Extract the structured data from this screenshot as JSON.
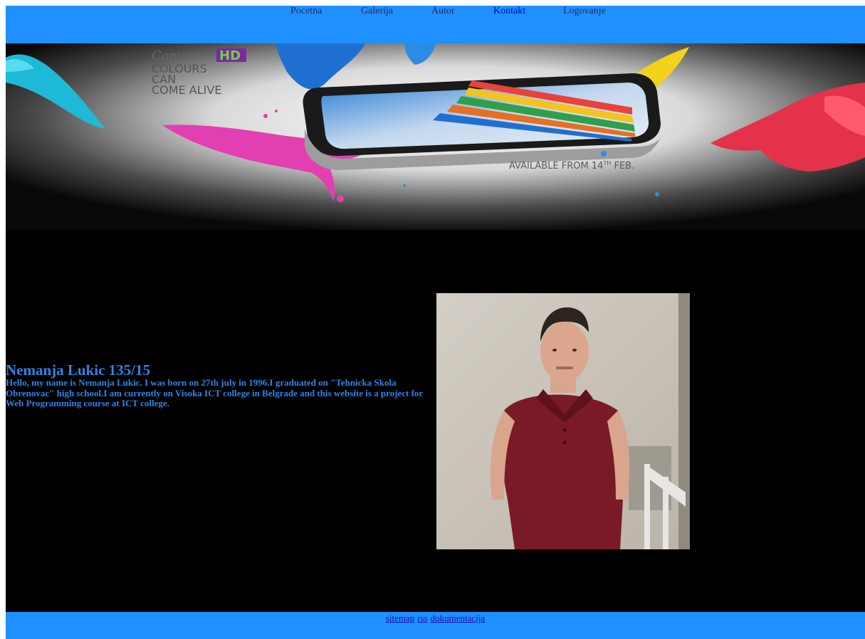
{
  "nav": {
    "items": [
      {
        "label": "Pocetna"
      },
      {
        "label": "Galerija"
      },
      {
        "label": "Autor"
      },
      {
        "label": "Kontakt"
      },
      {
        "label": "Logovanje"
      }
    ]
  },
  "banner": {
    "brand_prefix": "Canvas",
    "brand_suffix": "HD",
    "tagline_1": "COLOURS",
    "tagline_2": "CAN",
    "tagline_3": "COME ALIVE",
    "availability_main": "AVAILABLE FROM 14",
    "availability_sup": "TH",
    "availability_end": " FEB."
  },
  "about": {
    "title": "Nemanja Lukic 135/15",
    "text": "Hello, my name is Nemanja Lukic. I was born on 27th july in 1996.I graduated on \"Tehnicka Skola Obrenovac\" high school.I am currently on Visoka ICT college in Belgrade and this website is a project for Web Programming course at ICT college."
  },
  "footer": {
    "links": [
      {
        "label": "sitemap"
      },
      {
        "label": "rss"
      },
      {
        "label": "dokumentacija"
      }
    ]
  },
  "colors": {
    "nav_background": "#1e90ff",
    "footer_background": "#1e90ff",
    "content_background": "#000000",
    "text_accent": "#2f84e6"
  }
}
